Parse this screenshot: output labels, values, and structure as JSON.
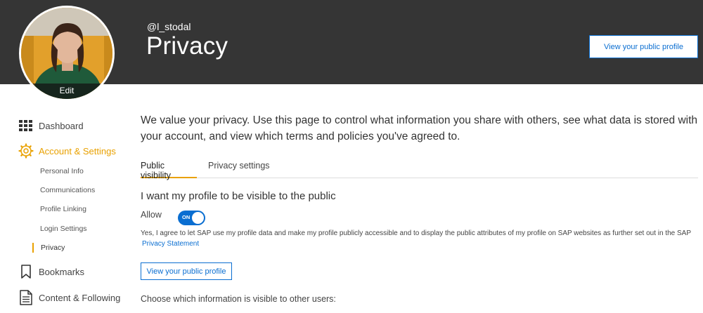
{
  "header": {
    "username": "@l_stodal",
    "title": "Privacy",
    "public_profile_button": "View your public profile",
    "avatar_edit": "Edit"
  },
  "sidebar": {
    "items": [
      {
        "label": "Dashboard",
        "icon": "grid-icon"
      },
      {
        "label": "Account & Settings",
        "icon": "gear-icon",
        "active": true
      },
      {
        "label": "Bookmarks",
        "icon": "bookmark-icon"
      },
      {
        "label": "Content & Following",
        "icon": "document-icon"
      }
    ],
    "sub_items": [
      "Personal Info",
      "Communications",
      "Profile Linking",
      "Login Settings",
      "Privacy"
    ],
    "current": "Privacy"
  },
  "main": {
    "intro": "We value your privacy. Use this page to control what information you share with others, see what data is stored with your account, and view which terms and policies you've agreed to.",
    "tabs": [
      "Public visibility",
      "Privacy settings"
    ],
    "section_title": "I want my profile to be visible to the public",
    "allow_label": "Allow",
    "toggle_state": "ON",
    "consent_text": "Yes, I agree to let SAP use my profile data and make my profile publicly accessible and to display the public attributes of my profile on SAP websites as further set out in the SAP",
    "privacy_link": "Privacy Statement",
    "view_profile_button": "View your public profile",
    "choose_text": "Choose which information is visible to other users:"
  },
  "colors": {
    "header_bg": "#353535",
    "accent": "#e9a100",
    "link": "#0a6ed1"
  }
}
